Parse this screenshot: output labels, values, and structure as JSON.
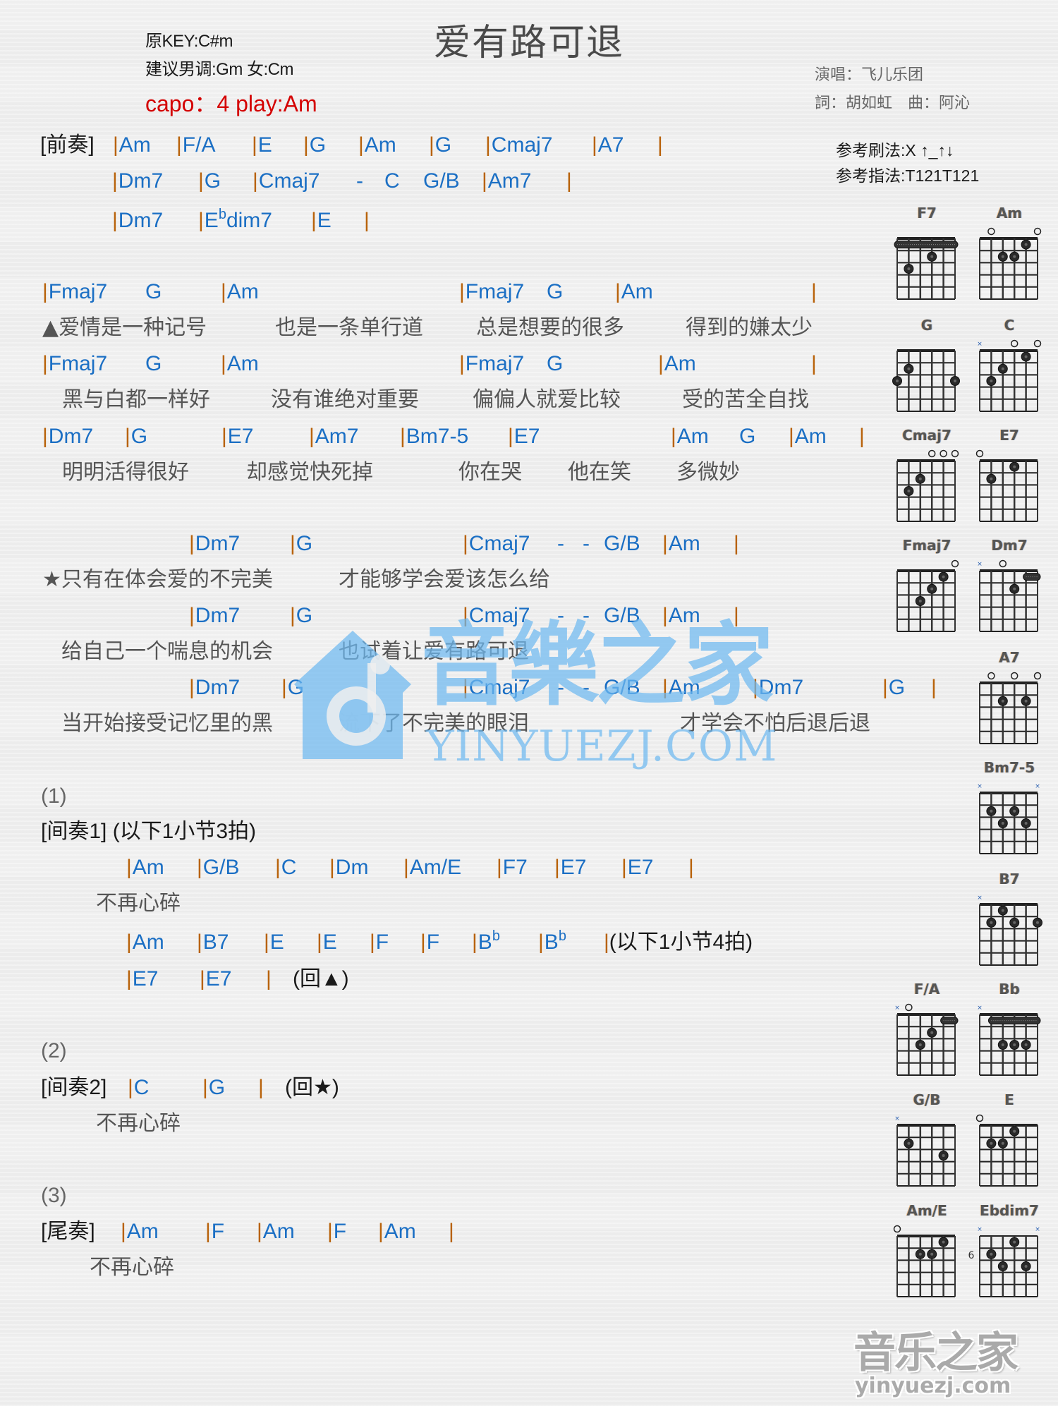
{
  "header": {
    "title": "爱有路可退",
    "original_key": "原KEY:C#m",
    "suggested_key": "建议男调:Gm 女:Cm",
    "capo": "capo：4 play:Am",
    "singer": "演唱：飞儿乐团",
    "lyricist_composer": "詞：胡如虹　曲：阿沁",
    "strum_pattern": "参考刷法:X ↑_↑↓",
    "finger_pattern": "参考指法:T121T121"
  },
  "colors": {
    "chord": "#1b6fc4",
    "barline": "#b8620a",
    "lyric": "#555555",
    "capo": "#d40000",
    "watermark": "#6eb9f0"
  },
  "sheet": {
    "lines": [
      {
        "kind": "chords",
        "tokens": [
          {
            "type": "label",
            "text": "[前奏]"
          },
          {
            "type": "chord",
            "bar": true,
            "text": "Am"
          },
          {
            "type": "chord",
            "bar": true,
            "text": "F/A"
          },
          {
            "type": "chord",
            "bar": true,
            "text": "E"
          },
          {
            "type": "chord",
            "bar": true,
            "text": "G"
          },
          {
            "type": "chord",
            "bar": true,
            "text": "Am"
          },
          {
            "type": "chord",
            "bar": true,
            "text": "G"
          },
          {
            "type": "chord",
            "bar": true,
            "text": "Cmaj7"
          },
          {
            "type": "chord",
            "bar": true,
            "text": "A7"
          },
          {
            "type": "barline",
            "text": "|"
          }
        ]
      },
      {
        "kind": "chords",
        "tokens": [
          {
            "type": "chord",
            "bar": true,
            "text": "Dm7"
          },
          {
            "type": "chord",
            "bar": true,
            "text": "G"
          },
          {
            "type": "chord",
            "bar": true,
            "text": "Cmaj7"
          },
          {
            "type": "dash",
            "text": "-"
          },
          {
            "type": "chord",
            "bar": false,
            "text": "C"
          },
          {
            "type": "chord",
            "bar": false,
            "text": "G/B"
          },
          {
            "type": "chord",
            "bar": true,
            "text": "Am7"
          },
          {
            "type": "barline",
            "text": "|"
          }
        ]
      },
      {
        "kind": "chords",
        "tokens": [
          {
            "type": "chord",
            "bar": true,
            "text": "Dm7"
          },
          {
            "type": "chord",
            "bar": true,
            "text": "E",
            "sup": "b",
            "suffix": "dim7"
          },
          {
            "type": "chord",
            "bar": true,
            "text": "E"
          },
          {
            "type": "barline",
            "text": "|"
          }
        ]
      },
      {
        "kind": "chords",
        "tokens": [
          {
            "type": "chord",
            "bar": true,
            "text": "Fmaj7"
          },
          {
            "type": "chord",
            "bar": false,
            "text": "G"
          },
          {
            "type": "chord",
            "bar": true,
            "text": "Am"
          },
          {
            "type": "chord",
            "bar": true,
            "text": "Fmaj7"
          },
          {
            "type": "chord",
            "bar": false,
            "text": "G"
          },
          {
            "type": "chord",
            "bar": true,
            "text": "Am"
          },
          {
            "type": "barline",
            "text": "|"
          }
        ]
      },
      {
        "kind": "lyrics",
        "tokens": [
          "▲爱情是一种记号",
          "也是一条单行道",
          "总是想要的很多",
          "得到的嫌太少"
        ]
      },
      {
        "kind": "chords",
        "tokens": [
          {
            "type": "chord",
            "bar": true,
            "text": "Fmaj7"
          },
          {
            "type": "chord",
            "bar": false,
            "text": "G"
          },
          {
            "type": "chord",
            "bar": true,
            "text": "Am"
          },
          {
            "type": "chord",
            "bar": true,
            "text": "Fmaj7"
          },
          {
            "type": "chord",
            "bar": false,
            "text": "G"
          },
          {
            "type": "chord",
            "bar": true,
            "text": "Am"
          },
          {
            "type": "barline",
            "text": "|"
          }
        ]
      },
      {
        "kind": "lyrics",
        "tokens": [
          "黑与白都一样好",
          "没有谁绝对重要",
          "偏偏人就爱比较",
          "受的苦全自找"
        ]
      },
      {
        "kind": "chords",
        "tokens": [
          {
            "type": "chord",
            "bar": true,
            "text": "Dm7"
          },
          {
            "type": "chord",
            "bar": true,
            "text": "G"
          },
          {
            "type": "chord",
            "bar": true,
            "text": "E7"
          },
          {
            "type": "chord",
            "bar": true,
            "text": "Am7"
          },
          {
            "type": "chord",
            "bar": true,
            "text": "Bm7-5"
          },
          {
            "type": "chord",
            "bar": true,
            "text": "E7"
          },
          {
            "type": "chord",
            "bar": true,
            "text": "Am"
          },
          {
            "type": "chord",
            "bar": false,
            "text": "G"
          },
          {
            "type": "chord",
            "bar": true,
            "text": "Am"
          },
          {
            "type": "barline",
            "text": "|"
          }
        ]
      },
      {
        "kind": "lyrics",
        "tokens": [
          "明明活得很好",
          "却感觉快死掉",
          "你在哭",
          "他在笑",
          "多微妙"
        ]
      },
      {
        "kind": "chords",
        "tokens": [
          {
            "type": "chord",
            "bar": true,
            "text": "Dm7"
          },
          {
            "type": "chord",
            "bar": true,
            "text": "G"
          },
          {
            "type": "chord",
            "bar": true,
            "text": "Cmaj7"
          },
          {
            "type": "dash",
            "text": "-"
          },
          {
            "type": "dash",
            "text": "-"
          },
          {
            "type": "chord",
            "bar": false,
            "text": "G/B"
          },
          {
            "type": "chord",
            "bar": true,
            "text": "Am"
          },
          {
            "type": "barline",
            "text": "|"
          }
        ]
      },
      {
        "kind": "lyrics",
        "tokens": [
          "★只有在体会爱的不完美",
          "才能够学会爱该怎么给"
        ]
      },
      {
        "kind": "chords",
        "tokens": [
          {
            "type": "chord",
            "bar": true,
            "text": "Dm7"
          },
          {
            "type": "chord",
            "bar": true,
            "text": "G"
          },
          {
            "type": "chord",
            "bar": true,
            "text": "Cmaj7"
          },
          {
            "type": "dash",
            "text": "-"
          },
          {
            "type": "dash",
            "text": "-"
          },
          {
            "type": "chord",
            "bar": false,
            "text": "G/B"
          },
          {
            "type": "chord",
            "bar": true,
            "text": "Am"
          },
          {
            "type": "barline",
            "text": "|"
          }
        ]
      },
      {
        "kind": "lyrics",
        "tokens": [
          "给自己一个喘息的机会",
          "也试着让爱有路可退"
        ]
      },
      {
        "kind": "chords",
        "tokens": [
          {
            "type": "chord",
            "bar": true,
            "text": "Dm7"
          },
          {
            "type": "chord",
            "bar": true,
            "text": "G"
          },
          {
            "type": "chord",
            "bar": true,
            "text": "Cmaj7"
          },
          {
            "type": "dash",
            "text": "-"
          },
          {
            "type": "dash",
            "text": "-"
          },
          {
            "type": "chord",
            "bar": false,
            "text": "G/B"
          },
          {
            "type": "chord",
            "bar": true,
            "text": "Am"
          },
          {
            "type": "chord",
            "bar": true,
            "text": "Dm7"
          },
          {
            "type": "chord",
            "bar": true,
            "text": "G"
          },
          {
            "type": "barline",
            "text": "|"
          }
        ]
      },
      {
        "kind": "lyrics",
        "tokens": [
          "当开始接受记忆里的黑",
          "流下了不完美的眼泪",
          "才学会不怕后退后退"
        ]
      },
      {
        "kind": "paren",
        "tokens": [
          "(1)"
        ]
      },
      {
        "kind": "chords",
        "tokens": [
          {
            "type": "label",
            "text": "[间奏1] (以下1小节3拍)"
          }
        ]
      },
      {
        "kind": "chords",
        "tokens": [
          {
            "type": "chord",
            "bar": true,
            "text": "Am"
          },
          {
            "type": "chord",
            "bar": true,
            "text": "G/B"
          },
          {
            "type": "chord",
            "bar": true,
            "text": "C"
          },
          {
            "type": "chord",
            "bar": true,
            "text": "Dm"
          },
          {
            "type": "chord",
            "bar": true,
            "text": "Am/E"
          },
          {
            "type": "chord",
            "bar": true,
            "text": "F7"
          },
          {
            "type": "chord",
            "bar": true,
            "text": "E7"
          },
          {
            "type": "chord",
            "bar": true,
            "text": "E7"
          },
          {
            "type": "barline",
            "text": "|"
          }
        ]
      },
      {
        "kind": "lyrics",
        "tokens": [
          "不再心碎"
        ]
      },
      {
        "kind": "chords",
        "tokens": [
          {
            "type": "chord",
            "bar": true,
            "text": "Am"
          },
          {
            "type": "chord",
            "bar": true,
            "text": "B7"
          },
          {
            "type": "chord",
            "bar": true,
            "text": "E"
          },
          {
            "type": "chord",
            "bar": true,
            "text": "E"
          },
          {
            "type": "chord",
            "bar": true,
            "text": "F"
          },
          {
            "type": "chord",
            "bar": true,
            "text": "F"
          },
          {
            "type": "chord",
            "bar": true,
            "text": "B",
            "sup": "b"
          },
          {
            "type": "chord",
            "bar": true,
            "text": "B",
            "sup": "b"
          },
          {
            "type": "note",
            "bar": true,
            "text": "(以下1小节4拍)"
          }
        ]
      },
      {
        "kind": "chords",
        "tokens": [
          {
            "type": "chord",
            "bar": true,
            "text": "E7"
          },
          {
            "type": "chord",
            "bar": true,
            "text": "E7"
          },
          {
            "type": "barline",
            "text": "|"
          },
          {
            "type": "note",
            "bar": false,
            "text": "(回▲)"
          }
        ]
      },
      {
        "kind": "paren",
        "tokens": [
          "(2)"
        ]
      },
      {
        "kind": "chords",
        "tokens": [
          {
            "type": "label",
            "text": "[间奏2]"
          },
          {
            "type": "chord",
            "bar": true,
            "text": "C"
          },
          {
            "type": "chord",
            "bar": true,
            "text": "G"
          },
          {
            "type": "barline",
            "text": "|"
          },
          {
            "type": "note",
            "bar": false,
            "text": "(回★)"
          }
        ]
      },
      {
        "kind": "lyrics",
        "tokens": [
          "不再心碎"
        ]
      },
      {
        "kind": "paren",
        "tokens": [
          "(3)"
        ]
      },
      {
        "kind": "chords",
        "tokens": [
          {
            "type": "label",
            "text": "[尾奏]"
          },
          {
            "type": "chord",
            "bar": true,
            "text": "Am"
          },
          {
            "type": "chord",
            "bar": true,
            "text": "F"
          },
          {
            "type": "chord",
            "bar": true,
            "text": "Am"
          },
          {
            "type": "chord",
            "bar": true,
            "text": "F"
          },
          {
            "type": "chord",
            "bar": true,
            "text": "Am"
          },
          {
            "type": "barline",
            "text": "|"
          }
        ]
      },
      {
        "kind": "lyrics",
        "tokens": [
          "不再心碎"
        ]
      }
    ]
  },
  "chord_diagrams": [
    {
      "name": "F7",
      "base_fret": 1,
      "markers": [
        "",
        "",
        "",
        "",
        "",
        ""
      ],
      "barres": [
        {
          "fret": 1,
          "from": 0,
          "to": 5
        }
      ],
      "dots": [
        [
          3,
          2
        ],
        [
          1,
          3
        ]
      ]
    },
    {
      "name": "Am",
      "base_fret": 1,
      "markers": [
        "",
        "o",
        "",
        "",
        "",
        "o"
      ],
      "barres": [],
      "dots": [
        [
          4,
          1
        ],
        [
          2,
          2
        ],
        [
          3,
          2
        ]
      ]
    },
    {
      "name": "G",
      "base_fret": 1,
      "markers": [
        "",
        "",
        "",
        "",
        "",
        ""
      ],
      "barres": [],
      "dots": [
        [
          1,
          2
        ],
        [
          0,
          3
        ],
        [
          5,
          3
        ]
      ]
    },
    {
      "name": "C",
      "base_fret": 1,
      "markers": [
        "x",
        "",
        "",
        "o",
        "",
        "o"
      ],
      "barres": [],
      "dots": [
        [
          4,
          1
        ],
        [
          2,
          2
        ],
        [
          1,
          3
        ]
      ]
    },
    {
      "name": "Cmaj7",
      "base_fret": 1,
      "markers": [
        "",
        "",
        "",
        "o",
        "o",
        "o"
      ],
      "barres": [],
      "dots": [
        [
          2,
          2
        ],
        [
          1,
          3
        ]
      ]
    },
    {
      "name": "E7",
      "base_fret": 1,
      "markers": [
        "o",
        "",
        "",
        "",
        "",
        ""
      ],
      "barres": [],
      "dots": [
        [
          3,
          1
        ],
        [
          1,
          2
        ]
      ]
    },
    {
      "name": "Fmaj7",
      "base_fret": 1,
      "markers": [
        "",
        "",
        "",
        "",
        "",
        "o"
      ],
      "barres": [],
      "dots": [
        [
          4,
          1
        ],
        [
          3,
          2
        ],
        [
          2,
          3
        ]
      ]
    },
    {
      "name": "Dm7",
      "base_fret": 1,
      "markers": [
        "x",
        "",
        "o",
        "",
        "",
        ""
      ],
      "barres": [
        {
          "fret": 1,
          "from": 4,
          "to": 5
        }
      ],
      "dots": [
        [
          3,
          2
        ]
      ]
    },
    {
      "name": "A7",
      "base_fret": 1,
      "markers": [
        "",
        "o",
        "",
        "o",
        "",
        "o"
      ],
      "barres": [],
      "dots": [
        [
          2,
          2
        ],
        [
          4,
          2
        ]
      ]
    },
    {
      "name": "Bm7-5",
      "base_fret": 1,
      "markers": [
        "x",
        "",
        "",
        "",
        "",
        "x"
      ],
      "barres": [],
      "dots": [
        [
          1,
          2
        ],
        [
          3,
          2
        ],
        [
          2,
          3
        ],
        [
          4,
          3
        ]
      ]
    },
    {
      "name": "B7",
      "base_fret": 1,
      "markers": [
        "x",
        "",
        "",
        "",
        "",
        ""
      ],
      "barres": [],
      "dots": [
        [
          2,
          1
        ],
        [
          1,
          2
        ],
        [
          3,
          2
        ],
        [
          5,
          2
        ]
      ]
    },
    {
      "name": "F/A",
      "base_fret": 1,
      "markers": [
        "x",
        "o",
        "",
        "",
        "",
        ""
      ],
      "barres": [
        {
          "fret": 1,
          "from": 4,
          "to": 5
        }
      ],
      "dots": [
        [
          3,
          2
        ],
        [
          2,
          3
        ]
      ]
    },
    {
      "name": "Bb",
      "base_fret": 1,
      "markers": [
        "x",
        "",
        "",
        "",
        "",
        ""
      ],
      "barres": [
        {
          "fret": 1,
          "from": 1,
          "to": 5
        }
      ],
      "dots": [
        [
          2,
          3
        ],
        [
          3,
          3
        ],
        [
          4,
          3
        ]
      ]
    },
    {
      "name": "G/B",
      "base_fret": 1,
      "markers": [
        "x",
        "",
        "",
        "",
        "",
        ""
      ],
      "barres": [],
      "dots": [
        [
          1,
          2
        ],
        [
          4,
          3
        ]
      ]
    },
    {
      "name": "E",
      "base_fret": 1,
      "markers": [
        "o",
        "",
        "",
        "",
        "",
        ""
      ],
      "barres": [],
      "dots": [
        [
          3,
          1
        ],
        [
          1,
          2
        ],
        [
          2,
          2
        ]
      ]
    },
    {
      "name": "Am/E",
      "base_fret": 1,
      "markers": [
        "o",
        "",
        "",
        "",
        "",
        ""
      ],
      "barres": [],
      "dots": [
        [
          4,
          1
        ],
        [
          2,
          2
        ],
        [
          3,
          2
        ]
      ]
    },
    {
      "name": "Ebdim7",
      "base_fret": 6,
      "markers": [
        "x",
        "",
        "",
        "",
        "",
        "x"
      ],
      "barres": [],
      "dots": [
        [
          3,
          1
        ],
        [
          1,
          2
        ],
        [
          2,
          3
        ],
        [
          4,
          3
        ]
      ]
    }
  ],
  "watermark": {
    "center_cn": "音樂之家",
    "center_en": "YINYUEZJ.COM",
    "corner_cn": "音乐之家",
    "corner_en": "yinyuezj.com"
  }
}
